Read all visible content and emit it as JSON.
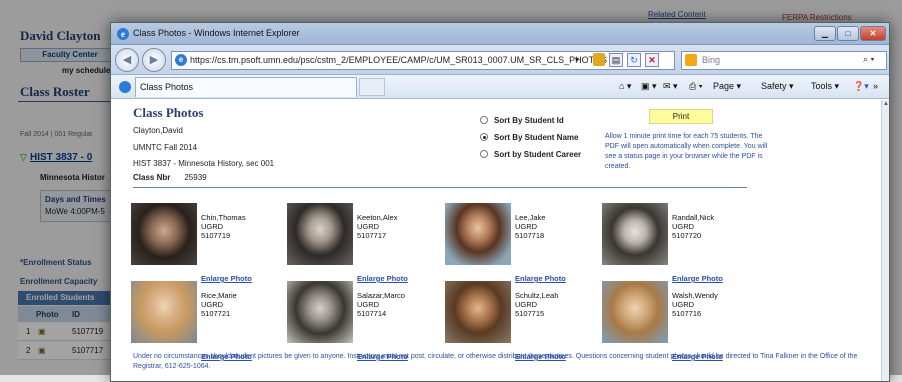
{
  "background_page": {
    "user_name": "David Clayton",
    "faculty_center_tab": "Faculty Center",
    "my_schedule": "my schedule",
    "page_title": "Class Roster",
    "term_line": "Fall 2014 | 001 Regular",
    "course_link": "HIST 3837 - 0",
    "course_desc": "Minnesota Histor",
    "days_times_label": "Days and Times",
    "days_times_value": "MoWe 4:00PM-5",
    "enrollment_status_label": "*Enrollment Status",
    "enrollment_capacity_label": "Enrollment Capacity",
    "enrolled_students_header": "Enrolled Students",
    "col_photo": "Photo",
    "col_id": "ID",
    "rows": [
      {
        "num": "1",
        "id": "5107719"
      },
      {
        "num": "2",
        "id": "5107717"
      }
    ],
    "related_content": "Related Content",
    "ferpa": "FERPA Restrictions"
  },
  "browser": {
    "title": "Class Photos - Windows Internet Explorer",
    "url": "https://cs.tm.psoft.umn.edu/psc/cstm_2/EMPLOYEE/CAMP/c/UM_SR013_0007.UM_SR_CLS_PHOTOS",
    "search_placeholder": "Bing",
    "tab_label": "Class Photos",
    "menu": {
      "page": "Page",
      "safety": "Safety",
      "tools": "Tools"
    }
  },
  "page": {
    "title": "Class Photos",
    "instructor": "Clayton,David",
    "term": "UMNTC  Fall 2014",
    "course": "HIST 3837 - Minnesota History, sec 001",
    "class_nbr_label": "Class Nbr",
    "class_nbr_value": "25939",
    "sort_options": [
      {
        "label": "Sort By Student Id",
        "selected": false
      },
      {
        "label": "Sort By Student Name",
        "selected": true
      },
      {
        "label": "Sort by Student Career",
        "selected": false
      }
    ],
    "print_label": "Print",
    "print_note": "Allow 1 minute print time for each 75 students. The PDF will open automatically when complete. You will see a status page in your browser while the PDF is created.",
    "students": [
      {
        "name": "Chin,Thomas",
        "level": "UGRD",
        "id": "5107719",
        "link": "Enlarge Photo"
      },
      {
        "name": "Keeton,Alex",
        "level": "UGRD",
        "id": "5107717",
        "link": "Enlarge Photo"
      },
      {
        "name": "Lee,Jake",
        "level": "UGRD",
        "id": "5107718",
        "link": "Enlarge Photo"
      },
      {
        "name": "Randall,Nick",
        "level": "UGRD",
        "id": "5107720",
        "link": "Enlarge Photo"
      },
      {
        "name": "Rice,Marie",
        "level": "UGRD",
        "id": "5107721",
        "link": "Enlarge Photo"
      },
      {
        "name": "Salazar,Marco",
        "level": "UGRD",
        "id": "5107714",
        "link": "Enlarge Photo"
      },
      {
        "name": "Schultz,Leah",
        "level": "UGRD",
        "id": "5107715",
        "link": "Enlarge Photo"
      },
      {
        "name": "Walsh,Wendy",
        "level": "UGRD",
        "id": "5107716",
        "link": "Enlarge Photo"
      }
    ],
    "footer": "Under no circumstances should student pictures be given to anyone. Instructors must not post, circulate, or otherwise distribute these pictures. Questions concerning student photos should be directed to Tina Falkner in the Office of the Registrar, 612-625-1064."
  }
}
